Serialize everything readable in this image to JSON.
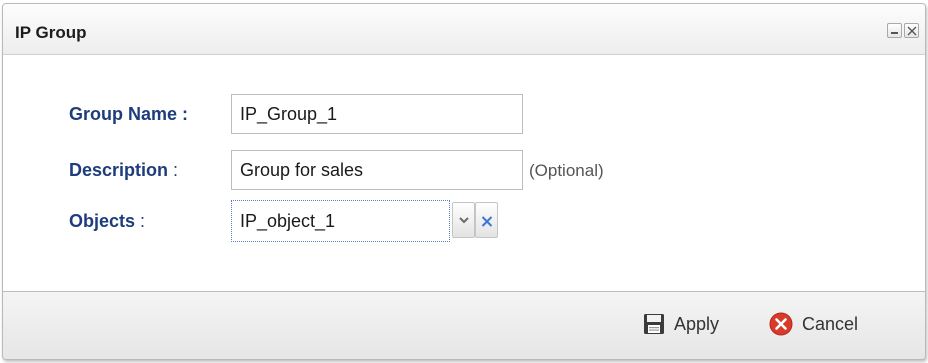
{
  "dialog": {
    "title": "IP Group"
  },
  "form": {
    "group_name": {
      "label": "Group Name",
      "colon": ":",
      "value": "IP_Group_1"
    },
    "description": {
      "label": "Description",
      "colon": ":",
      "value": "Group for sales",
      "hint": "(Optional)"
    },
    "objects": {
      "label": "Objects",
      "colon": ":",
      "value": "IP_object_1"
    }
  },
  "footer": {
    "apply_label": "Apply",
    "cancel_label": "Cancel"
  },
  "colors": {
    "label_blue": "#1f3c7d",
    "clear_icon_blue": "#3a78d6",
    "cancel_icon_red": "#d93b2b"
  },
  "icons": {
    "minimize": "minimize-icon",
    "close": "close-icon",
    "dropdown": "chevron-down-icon",
    "clear": "clear-x-icon",
    "apply": "floppy-disk-icon",
    "cancel": "cancel-circle-icon"
  }
}
